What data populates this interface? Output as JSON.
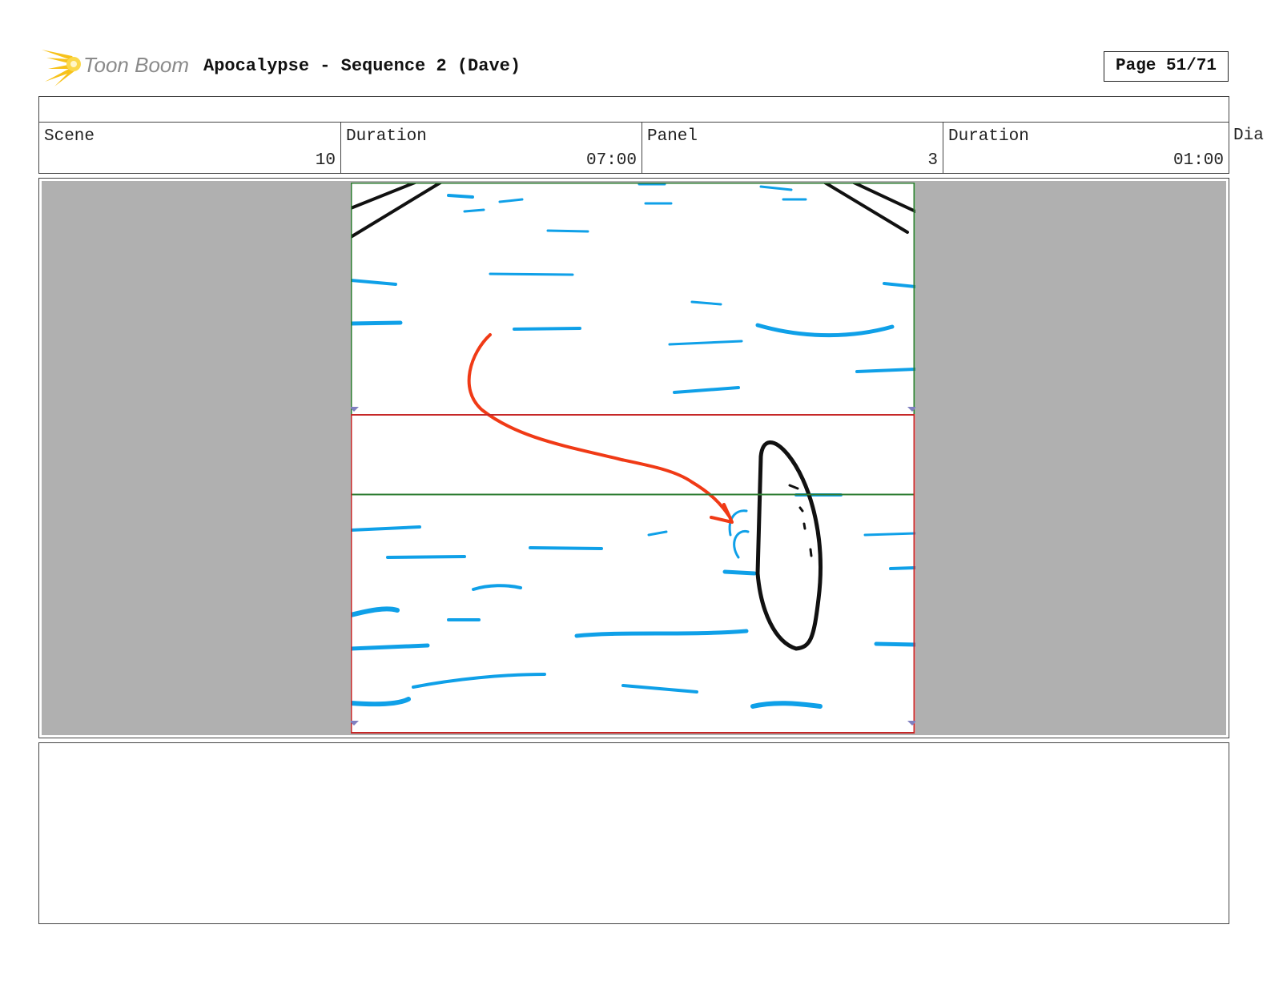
{
  "header": {
    "brand": "Toon Boom",
    "title": "Apocalypse - Sequence 2 (Dave)",
    "page": "Page 51/71"
  },
  "info": {
    "scene_label": "Scene",
    "scene_value": "10",
    "scene_duration_label": "Duration",
    "scene_duration_value": "07:00",
    "panel_label": "Panel",
    "panel_value": "3",
    "panel_duration_label": "Duration",
    "panel_duration_value": "01:00",
    "dialog_label_partial": "Dia"
  },
  "colors": {
    "water": "#0fa0e8",
    "motion_arrow": "#f03a16",
    "camera_frame_start": "#2e7d32",
    "camera_frame_end": "#c62828",
    "background_gray": "#b0b0b0",
    "logo_star": "#f7c21a"
  },
  "notes": {
    "text": ""
  }
}
